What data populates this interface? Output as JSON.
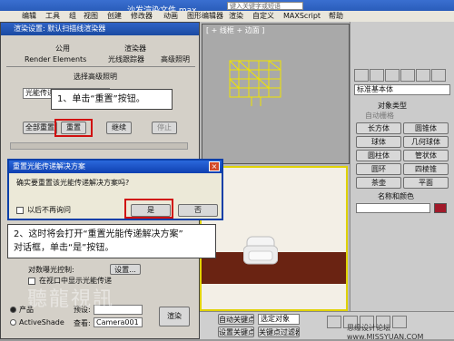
{
  "app": {
    "title": "沙发渲染文件.max"
  },
  "menu": [
    "编辑",
    "工具",
    "组",
    "视图",
    "创建",
    "修改器",
    "动画",
    "图形编辑器",
    "渲染",
    "自定义",
    "MAXScript",
    "帮助"
  ],
  "toolbar": {
    "search_placeholder": "键入关键字或短语"
  },
  "viewport_top": {
    "label": "[ + 线框 + 边面 ]"
  },
  "command_panel": {
    "dropdown": "标准基本体",
    "object_type_header": "对象类型",
    "autogrid": "自动栅格",
    "buttons": [
      "长方体",
      "圆锥体",
      "球体",
      "几何球体",
      "圆柱体",
      "管状体",
      "圆环",
      "四棱锥",
      "茶壶",
      "平面"
    ],
    "name_color_header": "名称和颜色"
  },
  "render_dialog": {
    "title": "渲染设置: 默认扫描线渲染器",
    "tabs_row1": [
      "公用",
      "渲染器"
    ],
    "tabs_row2": [
      "Render Elements",
      "光线跟踪器",
      "高级照明"
    ],
    "section_header": "选择高级照明",
    "dropdown_value": "光能传递",
    "reset_all": "全部重置",
    "reset": "重置",
    "continue": "继续",
    "stop": "停止",
    "interactive_label": "对数曝光控制:",
    "settings_btn": "设置...",
    "checkbox_label": "在视口中显示光能传递",
    "product_radio": "产品",
    "activeshade_radio": "ActiveShade",
    "preset_label": "预设:",
    "view_label": "查看:",
    "view_value": "Camera001",
    "render_btn": "渲染"
  },
  "confirm_dialog": {
    "title": "重置光能传递解决方案",
    "message": "确实要重置该光能传递解决方案吗?",
    "dont_ask": "以后不再询问",
    "yes": "是",
    "no": "否"
  },
  "callouts": {
    "step1": "1、单击“重置”按钮。",
    "step2_line1": "2、这时将会打开“重置光能传递解决方案”",
    "step2_line2": "对话框，单击“是”按钮。"
  },
  "bottom_bar": {
    "auto_key": "自动关键点",
    "selected": "选定对象",
    "set_key": "设置关键点",
    "key_filter": "关键点过滤器..."
  },
  "watermark": {
    "left": "聽龍視訊",
    "right": "思缘设计论坛 www.MISSYUAN.COM"
  },
  "colors": {
    "accent_red": "#d01010",
    "title_blue": "#2f63c6",
    "floor": "#6a2312",
    "viewport_border": "#e0d200"
  }
}
